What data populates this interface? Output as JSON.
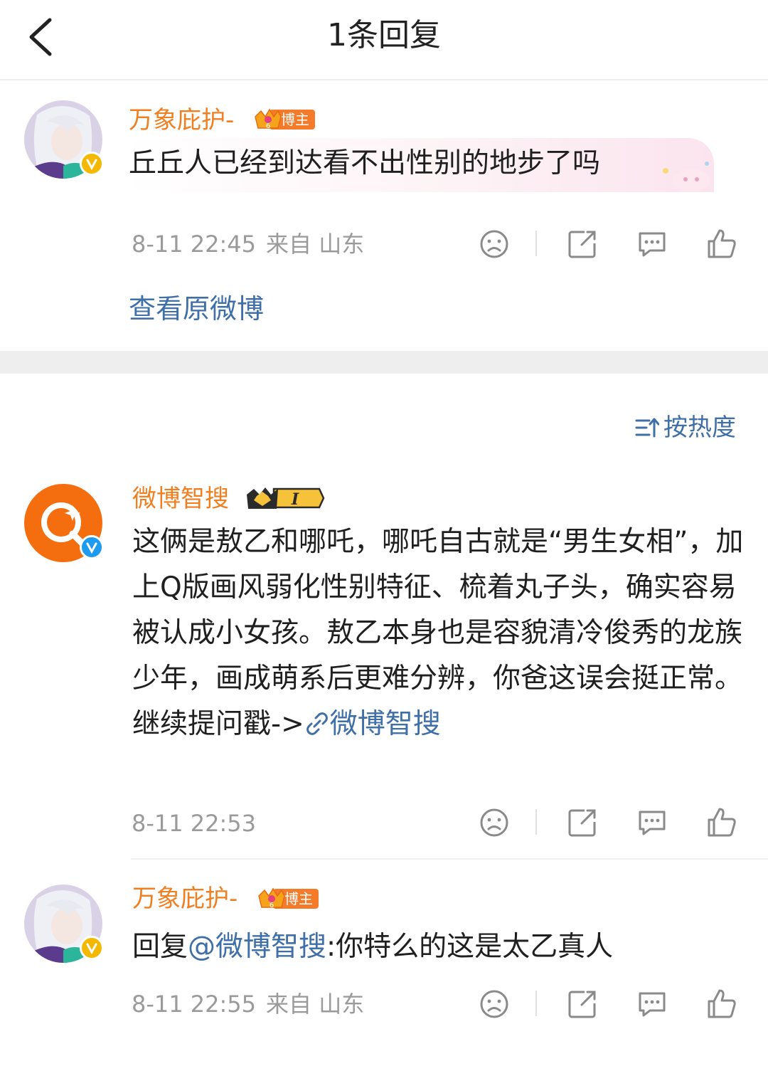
{
  "header": {
    "title": "1条回复"
  },
  "root_comment": {
    "username": "万象庇护-",
    "badge_label": "博主",
    "badge_level": "6",
    "text": "丘丘人已经到达看不出性别的地步了吗",
    "time": "8-11 22:45",
    "location": "来自 山东",
    "view_original": "查看原微博"
  },
  "sort": {
    "label": "按热度"
  },
  "replies": [
    {
      "username": "微博智搜",
      "badge_level": "I",
      "text": "这俩是敖乙和哪吒，哪吒自古就是“男生女相”，加上Q版画风弱化性别特征、梳着丸子头，确实容易被认成小女孩。敖乙本身也是容貌清冷俊秀的龙族少年，画成萌系后更难分辨，你爸这误会挺正常。继续提问戳->",
      "link_text": "微博智搜",
      "time": "8-11 22:53"
    },
    {
      "username": "万象庇护-",
      "badge_label": "博主",
      "badge_level": "6",
      "reply_prefix": "回复",
      "mention": "@微博智搜",
      "text": ":你特么的这是太乙真人",
      "time": "8-11 22:55",
      "location": "来自 山东"
    }
  ],
  "icons": {
    "back": "chevron-left-icon",
    "dislike": "sad-face-icon",
    "share": "share-icon",
    "comment": "comment-icon",
    "like": "thumbs-up-icon",
    "sort": "sort-icon",
    "link": "link-icon"
  },
  "colors": {
    "username": "#f07f21",
    "link": "#3f6fa8",
    "meta": "#9a9a9a",
    "verified_yellow": "#f5b800",
    "verified_blue": "#1d9bf0",
    "bot_avatar": "#f46e0f"
  }
}
